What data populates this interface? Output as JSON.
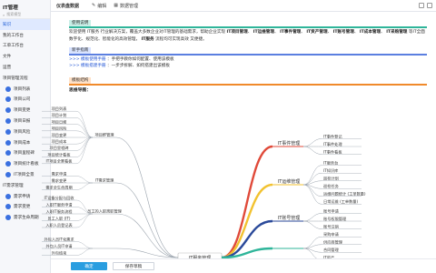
{
  "sidebar": {
    "title": "IT管理",
    "search_placeholder": "搜索模型",
    "items": [
      {
        "label": "知识",
        "active": true,
        "child": false,
        "dot": false
      },
      {
        "label": "我的工作台",
        "child": false,
        "dot": false
      },
      {
        "label": "工单工作台",
        "child": false,
        "dot": false
      },
      {
        "label": "文件",
        "child": false,
        "dot": false
      },
      {
        "label": "运营",
        "child": false,
        "dot": false
      },
      {
        "label": "项目管理流程",
        "child": false,
        "dot": false
      },
      {
        "label": "项目列表",
        "child": true,
        "dot": true
      },
      {
        "label": "项目公司",
        "child": true,
        "dot": true
      },
      {
        "label": "项目变更",
        "child": true,
        "dot": true
      },
      {
        "label": "项目日报",
        "child": true,
        "dot": true
      },
      {
        "label": "项目风险",
        "child": true,
        "dot": true
      },
      {
        "label": "项目成本",
        "child": true,
        "dot": true
      },
      {
        "label": "项目里程碑",
        "child": true,
        "dot": true
      },
      {
        "label": "项目统计看板",
        "child": true,
        "dot": true
      },
      {
        "label": "IT项目全景",
        "child": true,
        "dot": true
      },
      {
        "label": "IT需求管理",
        "child": false,
        "dot": false
      },
      {
        "label": "需求申请",
        "child": true,
        "dot": true
      },
      {
        "label": "需求变更",
        "child": true,
        "dot": true
      },
      {
        "label": "需求生命周期",
        "child": true,
        "dot": true
      }
    ]
  },
  "topbar": {
    "title": "仪表盘数据",
    "edit_label": "编辑",
    "manage_label": "数据管理"
  },
  "sections": {
    "intro_label": "使用说明",
    "intro_text_1": "欢迎使用 IT服务 行业解决方案，覆盖大多数企业对IT管理的基础需求，帮助企业实现",
    "intro_bold_1": "IT项目管理",
    "intro_bold_2": "IT运维管理",
    "intro_bold_3": "IT事件管理",
    "intro_bold_4": "IT资产管理",
    "intro_bold_5": "IT账号管理",
    "intro_bold_6": "IT成本管理",
    "intro_bold_7": "IT采购管理",
    "intro_text_2": "等IT全面数字化、规范化、智能化的高效管理，",
    "intro_bold_8": "IT服务",
    "intro_text_3": "流程均可实现高效 又便捷。",
    "guide_label": "新手指南",
    "link1": ">>> 模板使用手册",
    "link1_desc": "：手把手教你如何配置、使用该模板",
    "link2": ">>> 模板搭建手册",
    "link2_desc": "：一步步拆解、如何搭建出该模板",
    "mindmap_section_label": "模板结构",
    "mindmap_title": "思维导图："
  },
  "mindmap": {
    "left_group_1": {
      "title": "项目群管理",
      "leaves": [
        "项目列表",
        "项目计划",
        "项目日报",
        "项目风险",
        "项目变更",
        "项目成本",
        "项目里程碑",
        "项目统计看板",
        "IT项目全景看板"
      ]
    },
    "left_group_2": {
      "title": "IT需求管理",
      "leaves": [
        "需求申请",
        "需求变更",
        "需求全生命周期"
      ]
    },
    "left_group_3": {
      "title": "员工的入职离职管理",
      "leaves": [
        "IT设备分配与回收",
        "入职IT服务申请",
        "入职IT服务流程",
        "员工入职 (IT)",
        "入职人员登记表"
      ]
    },
    "left_group_4": {
      "title": "",
      "leaves": [
        "外包人员IT化需求",
        "外包人员IT申请",
        "外包结束"
      ]
    },
    "center": "IT服务管理",
    "right_group_1": {
      "title": "IT事件管理",
      "leaves": [
        "IT事件登记",
        "IT事件处理",
        "IT事件看板"
      ]
    },
    "right_group_2": {
      "title": "IT运维管理",
      "leaves": [
        "IT服务台",
        "IT知识库",
        "巡检计划",
        "巡检任务",
        "运维问题统计 (工单数量)",
        "日常运维 (工单数量)"
      ]
    },
    "right_group_3": {
      "title": "IT账号管理",
      "leaves": [
        "账号申请",
        "账号权限管理",
        "账号注销"
      ]
    },
    "right_group_4": {
      "title": "",
      "leaves": [
        "采购申请",
        "供应商管理",
        "合同管理",
        "IT资产"
      ]
    }
  },
  "footer": {
    "ok_label": "确定",
    "save_label": "保存草稿"
  },
  "colors": {
    "accent_blue": "#2a9ee0",
    "teal": "#2fb59a",
    "orange": "#f08a2b",
    "red": "#e04a3a",
    "yellow": "#f2c230",
    "navy": "#2b4a9a"
  }
}
